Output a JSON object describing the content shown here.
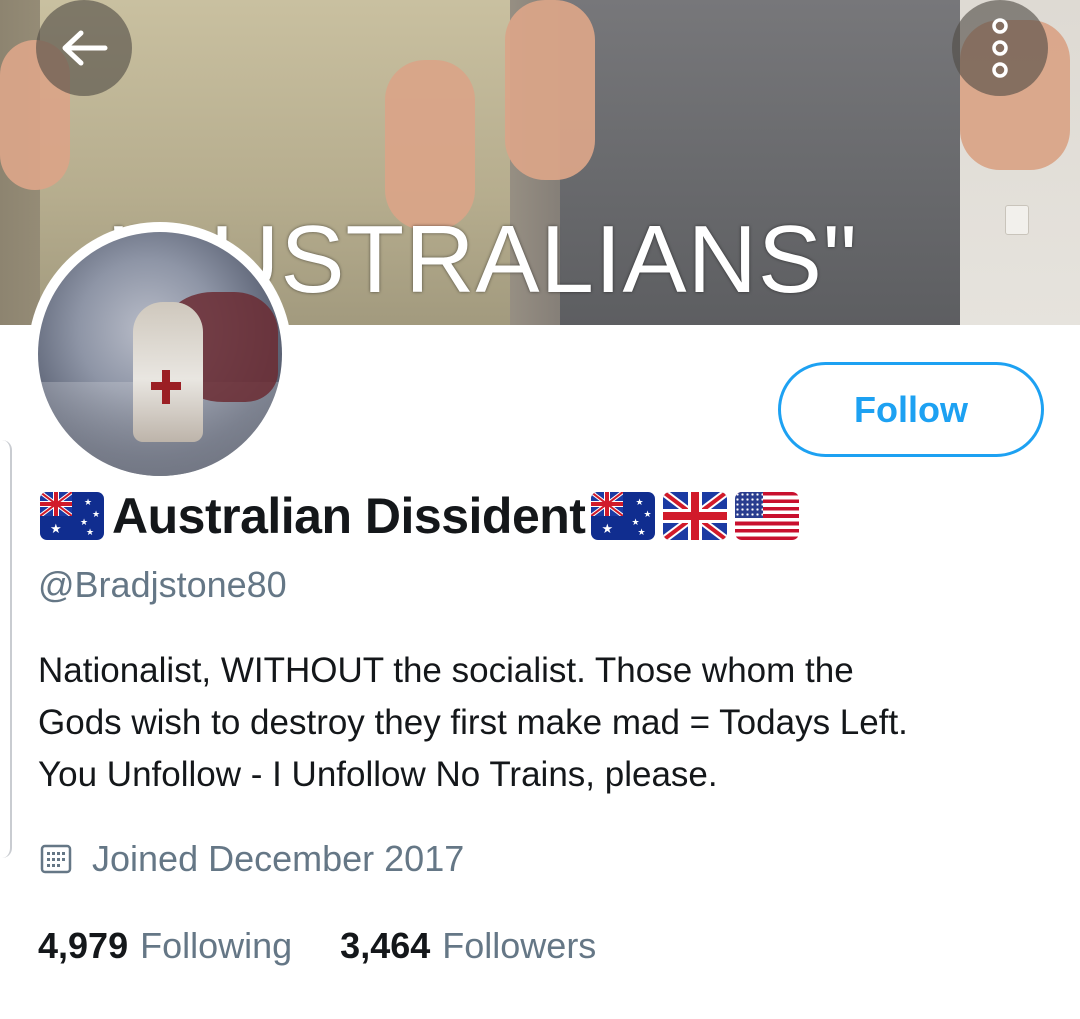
{
  "header": {
    "banner_caption": "\"AUSTRALIANS\"",
    "back_icon": "arrow-left-icon",
    "more_icon": "more-vertical-icon"
  },
  "profile": {
    "display_name": "Australian Dissident",
    "handle": "@Bradjstone80",
    "bio": "Nationalist, WITHOUT the socialist. Those whom the\nGods wish to destroy they first make mad = Todays Left.\nYou Unfollow - I Unfollow No Trains, please.",
    "joined": "Joined December 2017",
    "name_emojis_before": [
      "flag-australia"
    ],
    "name_emojis_after": [
      "flag-australia",
      "flag-united-kingdom",
      "flag-united-states"
    ]
  },
  "actions": {
    "follow_label": "Follow"
  },
  "stats": {
    "following_count": "4,979",
    "following_label": "Following",
    "followers_count": "3,464",
    "followers_label": "Followers"
  },
  "colors": {
    "accent": "#1da1f2",
    "secondary_text": "#657786",
    "primary_text": "#14171a"
  }
}
